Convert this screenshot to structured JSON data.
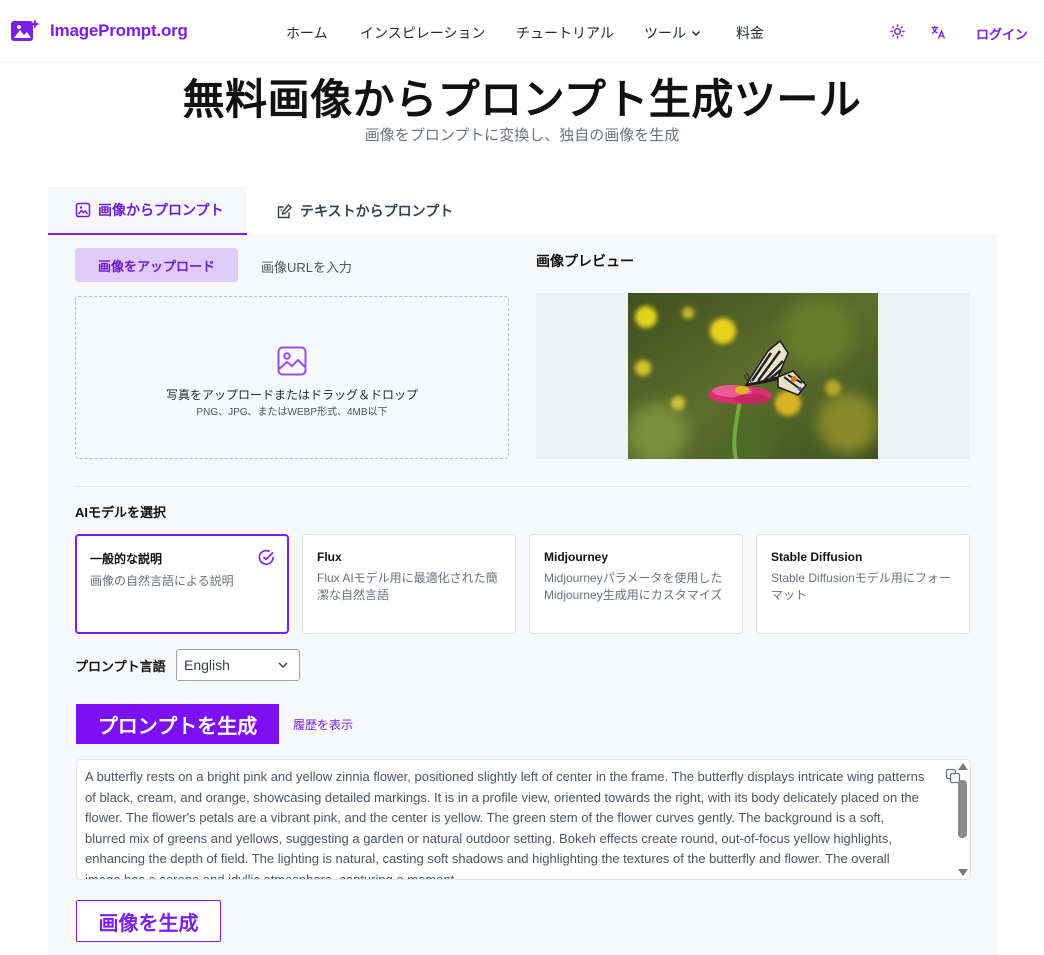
{
  "header": {
    "brand": "ImagePrompt.org",
    "nav": [
      {
        "label": "ホーム"
      },
      {
        "label": "インスピレーション"
      },
      {
        "label": "チュートリアル"
      },
      {
        "label": "ツール",
        "icon": "chevron-down-icon"
      },
      {
        "label": "料金"
      }
    ],
    "theme_icon": "sun-icon",
    "language_icon": "translate-icon",
    "login": "ログイン"
  },
  "hero": {
    "title": "無料画像からプロンプト生成ツール",
    "subtitle": "画像をプロンプトに変換し、独自の画像を生成"
  },
  "tabs": [
    {
      "label": "画像からプロンプト",
      "icon": "image-edit-icon",
      "active": true
    },
    {
      "label": "テキストからプロンプト",
      "icon": "note-edit-icon",
      "active": false
    }
  ],
  "upload": {
    "mode_upload": "画像をアップロード",
    "mode_url": "画像URLを入力",
    "dropzone_text": "写真をアップロードまたはドラッグ＆ドロップ",
    "dropzone_hint": "PNG、JPG、またはWEBP形式、4MB以下"
  },
  "preview": {
    "title": "画像プレビュー"
  },
  "models": {
    "label": "AIモデルを選択",
    "items": [
      {
        "title": "一般的な説明",
        "desc": "画像の自然言語による説明",
        "selected": true
      },
      {
        "title": "Flux",
        "desc": "Flux AIモデル用に最適化された簡潔な自然言語",
        "selected": false
      },
      {
        "title": "Midjourney",
        "desc": "Midjourneyパラメータを使用したMidjourney生成用にカスタマイズ",
        "selected": false
      },
      {
        "title": "Stable Diffusion",
        "desc": "Stable Diffusionモデル用にフォーマット",
        "selected": false
      }
    ]
  },
  "language": {
    "label": "プロンプト言語",
    "selected": "English"
  },
  "actions": {
    "generate": "プロンプトを生成",
    "history": "履歴を表示",
    "generate_image": "画像を生成"
  },
  "output": {
    "text": "A butterfly rests on a bright pink and yellow zinnia flower, positioned slightly left of center in the frame. The butterfly displays intricate wing patterns of black, cream, and orange, showcasing detailed markings. It is in a profile view, oriented towards the right, with its body delicately placed on the flower. The flower's petals are a vibrant pink, and the center is yellow. The green stem of the flower curves gently. The background is a soft, blurred mix of greens and yellows, suggesting a garden or natural outdoor setting. Bokeh effects create round, out-of-focus yellow highlights, enhancing the depth of field. The lighting is natural, casting soft shadows and highlighting the textures of the butterfly and flower. The overall image has a serene and idyllic atmosphere, capturing a moment"
  },
  "colors": {
    "accent": "#7c1ee8",
    "accent_light": "#e0cbfb",
    "panel_bg": "#f7f8fa"
  }
}
